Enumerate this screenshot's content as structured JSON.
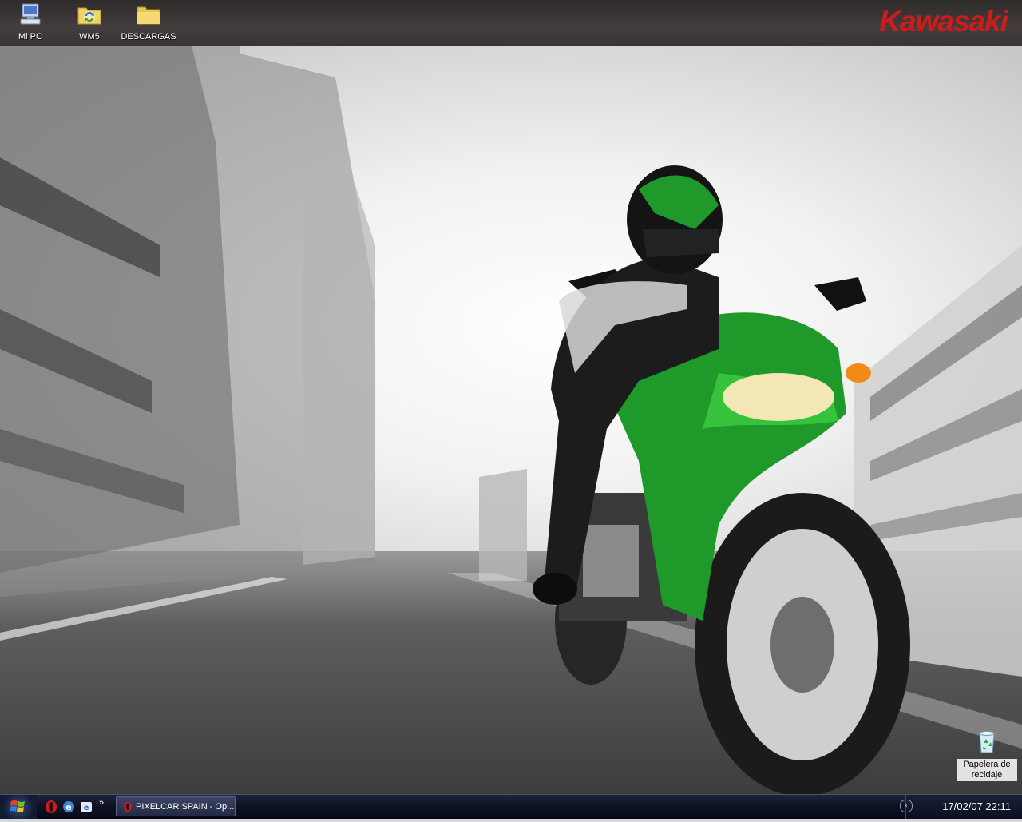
{
  "wallpaper": {
    "brand_text": "Kawasaki",
    "brand_color": "#d11a1a",
    "accent_green": "#1f9a2a"
  },
  "desktop": {
    "icons": [
      {
        "label": "Mi PC",
        "icon": "my-computer-icon"
      },
      {
        "label": "WM5",
        "icon": "sync-folder-icon"
      },
      {
        "label": "DESCARGAS",
        "icon": "folder-icon"
      },
      {
        "label": "Papelera de recidaje",
        "icon": "recycle-bin-icon"
      }
    ]
  },
  "taskbar": {
    "start_icon": "windows-logo-icon",
    "quick_launch": [
      {
        "icon": "opera-icon"
      },
      {
        "icon": "ie-browser-icon"
      },
      {
        "icon": "outlook-icon"
      }
    ],
    "overflow_glyph": "»",
    "tasks": [
      {
        "label": "PIXELCAR SPAIN - Op...",
        "icon": "opera-icon"
      }
    ],
    "tray": {
      "arrow_glyph": "‹",
      "clock": "17/02/07 22:11"
    }
  }
}
